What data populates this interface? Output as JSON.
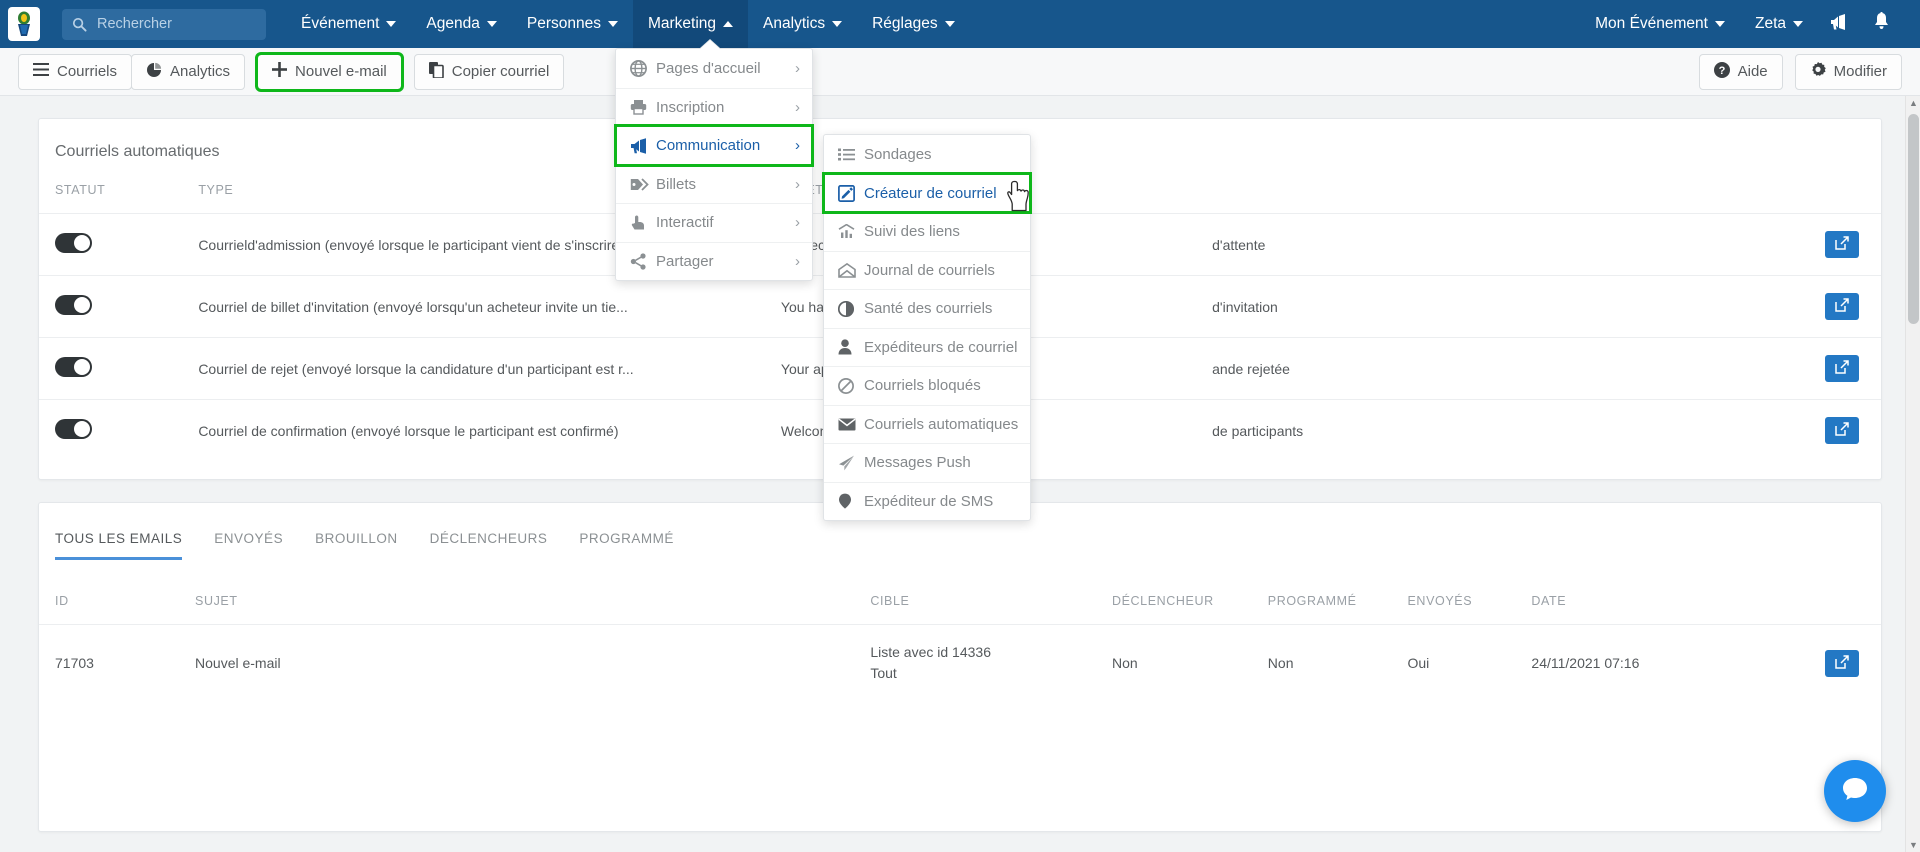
{
  "topnav": {
    "logo_icon": "event-logo-icon",
    "search": {
      "placeholder": "Rechercher",
      "value": "",
      "icon": "search-icon"
    },
    "items": [
      {
        "label": "Événement",
        "caret": "down",
        "active": false
      },
      {
        "label": "Agenda",
        "caret": "down",
        "active": false
      },
      {
        "label": "Personnes",
        "caret": "down",
        "active": false
      },
      {
        "label": "Marketing",
        "caret": "up",
        "active": true
      },
      {
        "label": "Analytics",
        "caret": "down",
        "active": false
      },
      {
        "label": "Réglages",
        "caret": "down",
        "active": false
      }
    ],
    "right_items": [
      {
        "label": "Mon Événement",
        "caret": "down"
      },
      {
        "label": "Zeta",
        "caret": "down"
      }
    ],
    "right_icons": [
      {
        "icon": "megaphone-icon",
        "name": "announcements-icon"
      },
      {
        "icon": "bell-icon",
        "name": "notifications-icon"
      }
    ],
    "accent_color": "#17568c"
  },
  "toolbar": {
    "left_group": [
      {
        "label": "Courriels",
        "icon": "hamburger-icon",
        "highlight": false
      },
      {
        "label": "Analytics",
        "icon": "pie-chart-icon",
        "highlight": false
      }
    ],
    "new_email": {
      "label": "Nouvel e-mail",
      "icon": "plus-icon",
      "highlight": true
    },
    "copy_email": {
      "label": "Copier courriel",
      "icon": "copy-icon",
      "highlight": false
    },
    "help": {
      "label": "Aide",
      "icon": "question-circle-icon"
    },
    "edit": {
      "label": "Modifier",
      "icon": "gear-icon"
    },
    "highlight_color": "#0eb71a"
  },
  "menu_l1": {
    "items": [
      {
        "label": "Pages d'accueil",
        "icon": "globe-icon",
        "arrow": "›",
        "selected": false,
        "highlight": false
      },
      {
        "label": "Inscription",
        "icon": "printer-icon",
        "arrow": "›",
        "selected": false,
        "highlight": false
      },
      {
        "label": "Communication",
        "icon": "megaphone-icon",
        "arrow": "›",
        "selected": true,
        "highlight": true
      },
      {
        "label": "Billets",
        "icon": "tag-icon",
        "arrow": "›",
        "selected": false,
        "highlight": false
      },
      {
        "label": "Interactif",
        "icon": "hand-pointer-icon",
        "arrow": "›",
        "selected": false,
        "highlight": false
      },
      {
        "label": "Partager",
        "icon": "share-icon",
        "arrow": "›",
        "selected": false,
        "highlight": false
      }
    ]
  },
  "menu_l2": {
    "items": [
      {
        "label": "Sondages",
        "icon": "list-icon",
        "selected": false,
        "highlight": false
      },
      {
        "label": "Créateur de courriel",
        "icon": "pencil-square-icon",
        "selected": true,
        "highlight": true
      },
      {
        "label": "Suivi des liens",
        "icon": "bar-chart-icon",
        "selected": false,
        "highlight": false
      },
      {
        "label": "Journal de courriels",
        "icon": "open-envelope-icon",
        "selected": false,
        "highlight": false
      },
      {
        "label": "Santé des courriels",
        "icon": "contrast-circle-icon",
        "selected": false,
        "highlight": false
      },
      {
        "label": "Expéditeurs de courriel",
        "icon": "user-icon",
        "selected": false,
        "highlight": false
      },
      {
        "label": "Courriels bloqués",
        "icon": "ban-icon",
        "selected": false,
        "highlight": false
      },
      {
        "label": "Courriels automatiques",
        "icon": "envelope-icon",
        "selected": false,
        "highlight": false
      },
      {
        "label": "Messages Push",
        "icon": "paper-plane-icon",
        "selected": false,
        "highlight": false
      },
      {
        "label": "Expéditeur de SMS",
        "icon": "sms-icon",
        "selected": false,
        "highlight": false
      }
    ]
  },
  "auto_emails": {
    "title": "Courriels automatiques",
    "columns": [
      "STATUT",
      "TYPE",
      "SUJET",
      "",
      ""
    ],
    "rows": [
      {
        "enabled": true,
        "type": "Courrield'admission (envoyé lorsque le participant vient de s'inscrire)",
        "subject": "We received your application:",
        "extra": "d'attente",
        "action_icon": "external-edit-icon"
      },
      {
        "enabled": true,
        "type": "Courriel de billet d'invitation (envoyé lorsqu'un acheteur invite un tie...",
        "subject": "You have been invited to {{event-name}}",
        "extra": "d'invitation",
        "action_icon": "external-edit-icon"
      },
      {
        "enabled": true,
        "type": "Courriel de rejet (envoyé lorsque la candidature d'un participant est r...",
        "subject": "Your application has been rejected",
        "extra": "ande rejetée",
        "action_icon": "external-edit-icon"
      },
      {
        "enabled": true,
        "type": "Courriel de confirmation (envoyé lorsque le participant est confirmé)",
        "subject": "Welcome to {{event-name}}",
        "extra": "de participants",
        "action_icon": "external-edit-icon"
      }
    ]
  },
  "emails_panel": {
    "tabs": [
      {
        "label": "TOUS LES EMAILS",
        "active": true
      },
      {
        "label": "ENVOYÉS",
        "active": false
      },
      {
        "label": "BROUILLON",
        "active": false
      },
      {
        "label": "DÉCLENCHEURS",
        "active": false
      },
      {
        "label": "PROGRAMMÉ",
        "active": false
      }
    ],
    "columns": [
      "ID",
      "SUJET",
      "CIBLE",
      "DÉCLENCHEUR",
      "PROGRAMMÉ",
      "ENVOYÉS",
      "DATE"
    ],
    "rows": [
      {
        "id": "71703",
        "subject": "Nouvel e-mail",
        "target_line1": "Liste avec id 14336",
        "target_line2": "Tout",
        "trigger": "Non",
        "scheduled": "Non",
        "sent": "Oui",
        "date": "24/11/2021 07:16",
        "action_icon": "external-edit-icon"
      }
    ]
  },
  "chat": {
    "icon": "chat-bubble-icon",
    "color": "#1f8ded"
  }
}
